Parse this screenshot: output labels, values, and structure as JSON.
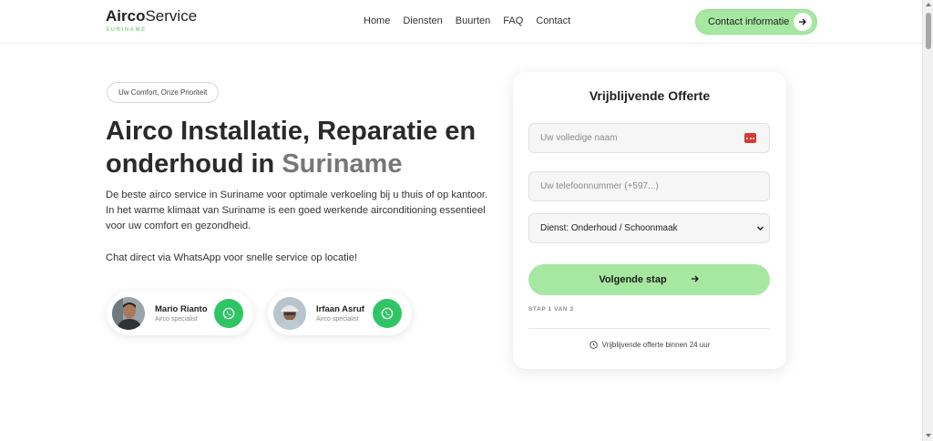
{
  "header": {
    "logo_main_bold": "Airco",
    "logo_main_rest": "Service",
    "logo_sub": "SURINAME",
    "nav": [
      "Home",
      "Diensten",
      "Buurten",
      "FAQ",
      "Contact"
    ],
    "contact_label": "Contact informatie"
  },
  "hero": {
    "tagline": "Uw Comfort, Onze Prioriteit",
    "title_main": "Airco Installatie, Reparatie en onderhoud in ",
    "title_accent": "Suriname",
    "description": "De beste airco service in Suriname voor optimale verkoeling bij u thuis of op kantoor. In het warme klimaat van Suriname is een goed werkende airconditioning essentieel voor uw comfort en gezondheid.",
    "chat_text": "Chat direct via WhatsApp voor snelle service op locatie!"
  },
  "agents": [
    {
      "name": "Mario Rianto",
      "role": "Airco specialist"
    },
    {
      "name": "Irfaan Asruf",
      "role": "Airco specialist"
    }
  ],
  "form": {
    "title": "Vrijblijvende Offerte",
    "name_placeholder": "Uw volledige naam",
    "phone_placeholder": "Uw telefoonnummer (+597...)",
    "service_selected": "Dienst: Onderhoud / Schoonmaak",
    "next_label": "Volgende stap",
    "step_label": "STAP 1 VAN 2",
    "footnote": "Vrijblijvende offerte binnen 24 uur"
  },
  "colors": {
    "accent_green": "#a6e8a2",
    "whatsapp_green": "#2fc564",
    "logo_sub": "#8ad68f"
  }
}
